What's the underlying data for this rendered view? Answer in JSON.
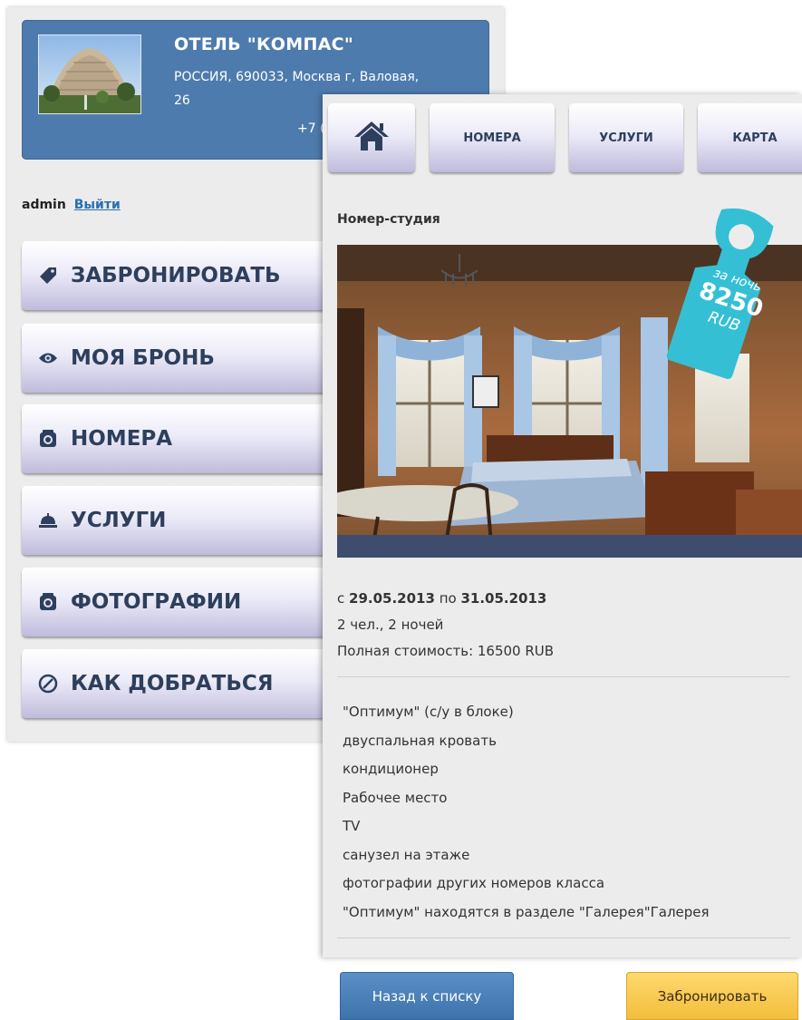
{
  "hotel": {
    "name": "ОТЕЛЬ \"КОМПАС\"",
    "address": "РОССИЯ, 690033, Москва г, Валовая, 26",
    "phone": "+7 (4"
  },
  "user": {
    "name": "admin",
    "logout_label": "Выйти"
  },
  "menu": {
    "items": [
      {
        "label": "ЗАБРОНИРОВАТЬ",
        "icon": "tag-icon"
      },
      {
        "label": "МОЯ БРОНЬ",
        "icon": "eye-icon"
      },
      {
        "label": "НОМЕРА",
        "icon": "camera-icon"
      },
      {
        "label": "УСЛУГИ",
        "icon": "service-bell-icon"
      },
      {
        "label": "ФОТОГРАФИИ",
        "icon": "camera-icon"
      },
      {
        "label": "КАК ДОБРАТЬСЯ",
        "icon": "compass-icon"
      }
    ]
  },
  "topnav": {
    "home_icon": "home-icon",
    "items": [
      "НОМЕРА",
      "УСЛУГИ",
      "КАРТА"
    ]
  },
  "room": {
    "title": "Номер-студия",
    "price_tag": {
      "per_night_label": "за ночь",
      "price": "8250",
      "currency": "RUB"
    },
    "dates_prefix": "с ",
    "date_from": "29.05.2013",
    "dates_mid": " по ",
    "date_to": "31.05.2013",
    "guests": "2 чел., 2 ночей",
    "total": "Полная стоимость: 16500 RUB",
    "features": [
      "\"Оптимум\" (с/у в блоке)",
      "двуспальная кровать",
      "кондиционер",
      "Рабочее место",
      "TV",
      "санузел на этаже",
      "фотографии других номеров класса",
      "\"Оптимум\"  находятся в разделе \"Галерея\"Галерея"
    ]
  },
  "actions": {
    "back_label": "Назад к списку",
    "book_label": "Забронировать"
  },
  "colors": {
    "header_blue": "#4e7bad",
    "price_tag_teal": "#39c3d6",
    "back_button": "#4a80ba",
    "book_button": "#f5c447"
  }
}
